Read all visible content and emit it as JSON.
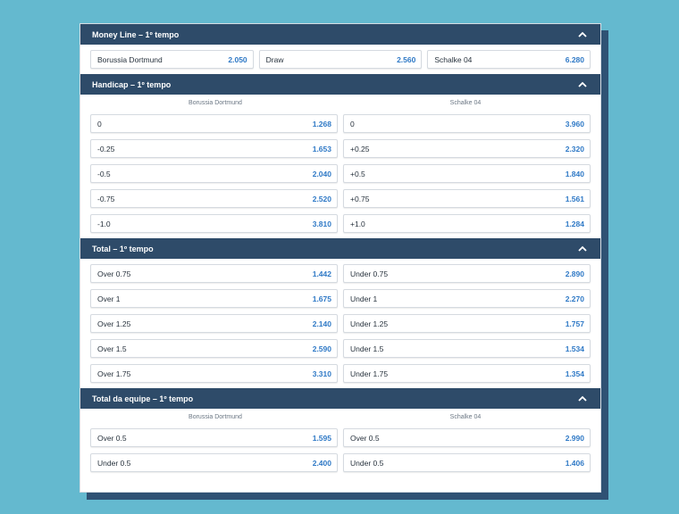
{
  "colors": {
    "background": "#64b9cf",
    "header": "#2e4b69",
    "odds": "#2f79c6"
  },
  "sections": [
    {
      "title": "Money Line – 1º tempo",
      "rows3": [
        [
          {
            "label": "Borussia Dortmund",
            "odd": "2.050"
          },
          {
            "label": "Draw",
            "odd": "2.560"
          },
          {
            "label": "Schalke 04",
            "odd": "6.280"
          }
        ]
      ]
    },
    {
      "title": "Handicap – 1º tempo",
      "teams": [
        "Borussia Dortmund",
        "Schalke 04"
      ],
      "rows": [
        [
          {
            "label": "0",
            "odd": "1.268"
          },
          {
            "label": "0",
            "odd": "3.960"
          }
        ],
        [
          {
            "label": "-0.25",
            "odd": "1.653"
          },
          {
            "label": "+0.25",
            "odd": "2.320"
          }
        ],
        [
          {
            "label": "-0.5",
            "odd": "2.040"
          },
          {
            "label": "+0.5",
            "odd": "1.840"
          }
        ],
        [
          {
            "label": "-0.75",
            "odd": "2.520"
          },
          {
            "label": "+0.75",
            "odd": "1.561"
          }
        ],
        [
          {
            "label": "-1.0",
            "odd": "3.810"
          },
          {
            "label": "+1.0",
            "odd": "1.284"
          }
        ]
      ]
    },
    {
      "title": "Total – 1º tempo",
      "rows": [
        [
          {
            "label": "Over 0.75",
            "odd": "1.442"
          },
          {
            "label": "Under 0.75",
            "odd": "2.890"
          }
        ],
        [
          {
            "label": "Over 1",
            "odd": "1.675"
          },
          {
            "label": "Under 1",
            "odd": "2.270"
          }
        ],
        [
          {
            "label": "Over 1.25",
            "odd": "2.140"
          },
          {
            "label": "Under 1.25",
            "odd": "1.757"
          }
        ],
        [
          {
            "label": "Over 1.5",
            "odd": "2.590"
          },
          {
            "label": "Under 1.5",
            "odd": "1.534"
          }
        ],
        [
          {
            "label": "Over 1.75",
            "odd": "3.310"
          },
          {
            "label": "Under 1.75",
            "odd": "1.354"
          }
        ]
      ]
    },
    {
      "title": "Total da equipe – 1º tempo",
      "teams": [
        "Borussia Dortmund",
        "Schalke 04"
      ],
      "rows": [
        [
          {
            "label": "Over 0.5",
            "odd": "1.595"
          },
          {
            "label": "Over 0.5",
            "odd": "2.990"
          }
        ],
        [
          {
            "label": "Under 0.5",
            "odd": "2.400"
          },
          {
            "label": "Under 0.5",
            "odd": "1.406"
          }
        ]
      ]
    }
  ]
}
